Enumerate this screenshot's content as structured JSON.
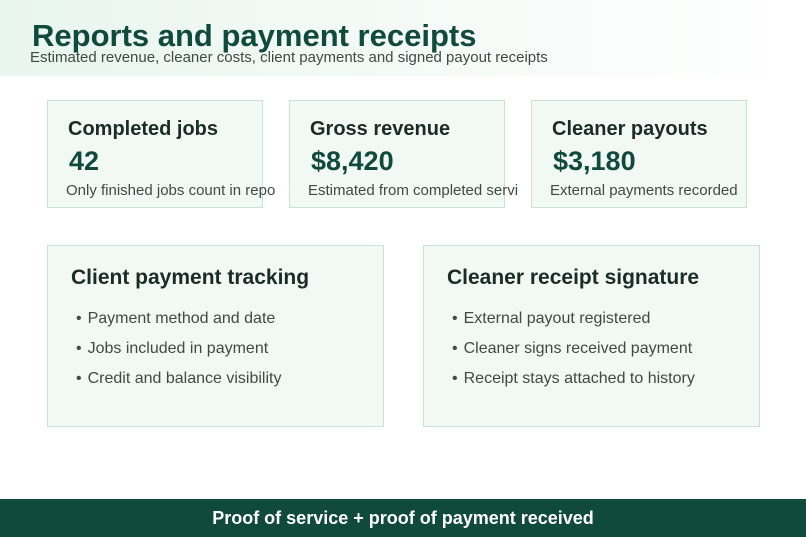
{
  "header": {
    "title": "Reports and payment receipts",
    "subtitle": "Estimated revenue, cleaner costs, client payments and signed payout receipts"
  },
  "stats": [
    {
      "label": "Completed jobs",
      "value": "42",
      "note": "Only finished jobs count in repo"
    },
    {
      "label": "Gross revenue",
      "value": "$8,420",
      "note": "Estimated from completed servi"
    },
    {
      "label": "Cleaner payouts",
      "value": "$3,180",
      "note": "External payments recorded"
    }
  ],
  "features": [
    {
      "title": "Client payment tracking",
      "items": [
        "Payment method and date",
        "Jobs included in payment",
        "Credit and balance visibility"
      ]
    },
    {
      "title": "Cleaner receipt signature",
      "items": [
        "External payout registered",
        "Cleaner signs received payment",
        "Receipt stays attached to history"
      ]
    }
  ],
  "bullet_glyph": "•",
  "footer": {
    "text": "Proof of service + proof of payment received"
  },
  "colors": {
    "brand": "#0f4a3c",
    "card_bg": "#f2f9f5",
    "card_border": "#c9e2d6"
  }
}
